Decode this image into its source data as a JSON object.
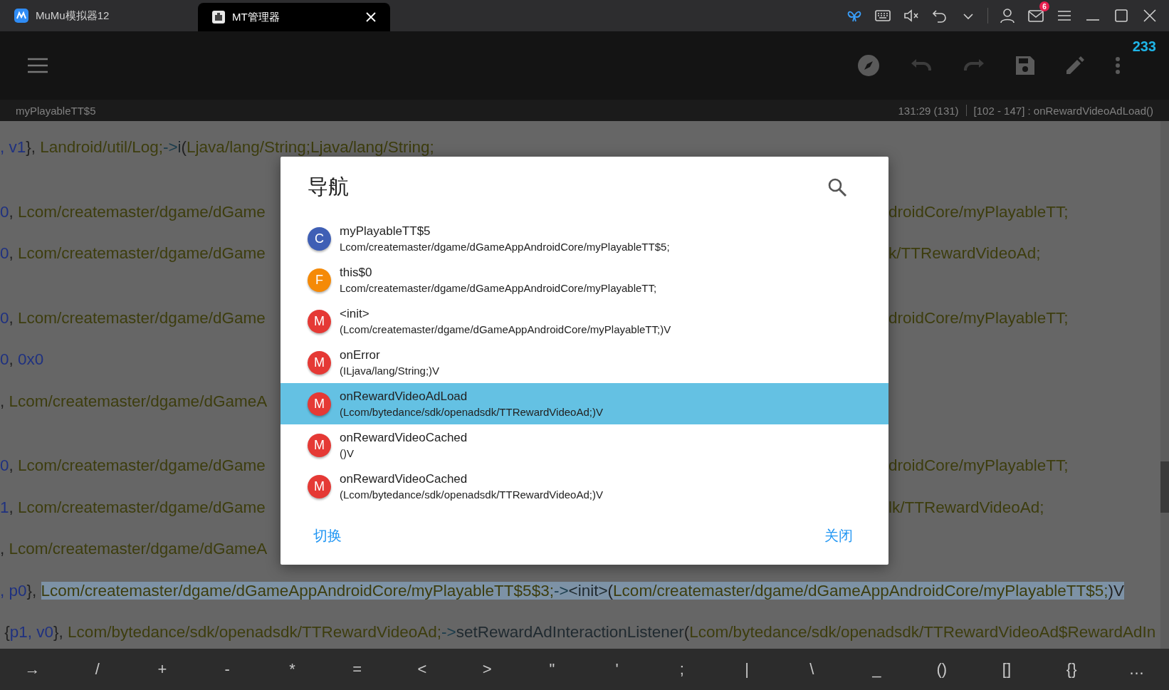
{
  "title_bar": {
    "tabs": [
      {
        "label": "MuMu模拟器12",
        "selected": false
      },
      {
        "label": "MT管理器",
        "selected": true
      }
    ],
    "mail_badge": "6"
  },
  "toolbar": {
    "counter": "233"
  },
  "status_bar": {
    "class_name": "myPlayableTT$5",
    "position": "131:29 (131)",
    "range": "[102 - 147] : onRewardVideoAdLoad()"
  },
  "editor": {
    "lines": [
      {
        "gap_before": false,
        "parts": [
          {
            "kind": "reg",
            "text": ", v1"
          },
          {
            "kind": "plain",
            "text": "}, "
          },
          {
            "kind": "type",
            "text": "Landroid/util/Log;"
          },
          {
            "kind": "op",
            "text": "->"
          },
          {
            "kind": "method",
            "text": "i"
          },
          {
            "kind": "plain",
            "text": "("
          },
          {
            "kind": "type",
            "text": "Ljava/lang/String;Ljava/lang/String;"
          }
        ]
      },
      {
        "gap_before": true,
        "parts": [
          {
            "kind": "reg",
            "text": "0"
          },
          {
            "kind": "plain",
            "text": ", "
          },
          {
            "kind": "type",
            "text": "Lcom/createmaster/dgame/dGame"
          }
        ],
        "right": "droidCore/myPlayableTT;"
      },
      {
        "gap_before": false,
        "parts": [
          {
            "kind": "reg",
            "text": "0"
          },
          {
            "kind": "plain",
            "text": ", "
          },
          {
            "kind": "type",
            "text": "Lcom/createmaster/dgame/dGame"
          }
        ],
        "right": "k/TTRewardVideoAd;"
      },
      {
        "gap_before": true,
        "parts": [
          {
            "kind": "reg",
            "text": "0"
          },
          {
            "kind": "plain",
            "text": ", "
          },
          {
            "kind": "type",
            "text": "Lcom/createmaster/dgame/dGame"
          }
        ],
        "right": "droidCore/myPlayableTT;"
      },
      {
        "gap_before": false,
        "parts": [
          {
            "kind": "reg",
            "text": "0"
          },
          {
            "kind": "plain",
            "text": ", "
          },
          {
            "kind": "reg",
            "text": "0x0"
          }
        ]
      },
      {
        "gap_before": false,
        "parts": [
          {
            "kind": "plain",
            "text": ", "
          },
          {
            "kind": "type",
            "text": "Lcom/createmaster/dgame/dGameA"
          }
        ]
      },
      {
        "gap_before": true,
        "parts": [
          {
            "kind": "reg",
            "text": "0"
          },
          {
            "kind": "plain",
            "text": ", "
          },
          {
            "kind": "type",
            "text": "Lcom/createmaster/dgame/dGame"
          }
        ],
        "right": "droidCore/myPlayableTT;"
      },
      {
        "gap_before": false,
        "parts": [
          {
            "kind": "reg",
            "text": "1"
          },
          {
            "kind": "plain",
            "text": ", "
          },
          {
            "kind": "type",
            "text": "Lcom/createmaster/dgame/dGame"
          }
        ],
        "right": "lk/TTRewardVideoAd;"
      },
      {
        "gap_before": false,
        "parts": [
          {
            "kind": "plain",
            "text": ", "
          },
          {
            "kind": "type",
            "text": "Lcom/createmaster/dgame/dGameA"
          }
        ]
      },
      {
        "gap_before": false,
        "parts": [
          {
            "kind": "reg",
            "text": ", p0",
            "highlighted": false
          },
          {
            "kind": "plain",
            "text": "}, ",
            "highlighted": false
          },
          {
            "kind": "type",
            "text": "Lcom/createmaster/dgame/dGameAppAndroidCore/myPlayableTT$5$3;",
            "highlighted": true
          },
          {
            "kind": "op",
            "text": "->",
            "highlighted": true
          },
          {
            "kind": "method",
            "text": "<init>",
            "highlighted": true
          },
          {
            "kind": "plain",
            "text": "(",
            "highlighted": true
          },
          {
            "kind": "type",
            "text": "Lcom/createmaster/dgame/dGameAppAndroidCore/myPlayableTT$5;",
            "highlighted": true
          },
          {
            "kind": "plain",
            "text": ")V",
            "highlighted": true
          }
        ]
      },
      {
        "gap_before": false,
        "parts": [
          {
            "kind": "plain",
            "text": " {"
          },
          {
            "kind": "reg",
            "text": "p1, v0"
          },
          {
            "kind": "plain",
            "text": "}, "
          },
          {
            "kind": "type",
            "text": "Lcom/bytedance/sdk/openadsdk/TTRewardVideoAd;"
          },
          {
            "kind": "op",
            "text": "->"
          },
          {
            "kind": "method",
            "text": "setRewardAdInteractionListener"
          },
          {
            "kind": "plain",
            "text": "("
          },
          {
            "kind": "type",
            "text": "Lcom/bytedance/sdk/openadsdk/TTRewardVideoAd$RewardAdIn"
          }
        ]
      }
    ]
  },
  "dialog": {
    "title": "导航",
    "items": [
      {
        "letter": "C",
        "color": "#3f5fb5",
        "name": "myPlayableTT$5",
        "signature": "Lcom/createmaster/dgame/dGameAppAndroidCore/myPlayableTT$5;",
        "selected": false
      },
      {
        "letter": "F",
        "color": "#f58a07",
        "name": "this$0",
        "signature": "Lcom/createmaster/dgame/dGameAppAndroidCore/myPlayableTT;",
        "selected": false
      },
      {
        "letter": "M",
        "color": "#e53935",
        "name": "<init>",
        "signature": "(Lcom/createmaster/dgame/dGameAppAndroidCore/myPlayableTT;)V",
        "selected": false
      },
      {
        "letter": "M",
        "color": "#e53935",
        "name": "onError",
        "signature": "(ILjava/lang/String;)V",
        "selected": false
      },
      {
        "letter": "M",
        "color": "#e53935",
        "name": "onRewardVideoAdLoad",
        "signature": "(Lcom/bytedance/sdk/openadsdk/TTRewardVideoAd;)V",
        "selected": true
      },
      {
        "letter": "M",
        "color": "#e53935",
        "name": "onRewardVideoCached",
        "signature": "()V",
        "selected": false
      },
      {
        "letter": "M",
        "color": "#e53935",
        "name": "onRewardVideoCached",
        "signature": "(Lcom/bytedance/sdk/openadsdk/TTRewardVideoAd;)V",
        "selected": false
      }
    ],
    "buttons": [
      "切换",
      "关闭"
    ]
  },
  "keys": [
    "→",
    "/",
    "+",
    "-",
    "*",
    "=",
    "<",
    ">",
    "\"",
    "'",
    ";",
    "|",
    "\\",
    "_",
    "()",
    "[]",
    "{}",
    "…"
  ]
}
